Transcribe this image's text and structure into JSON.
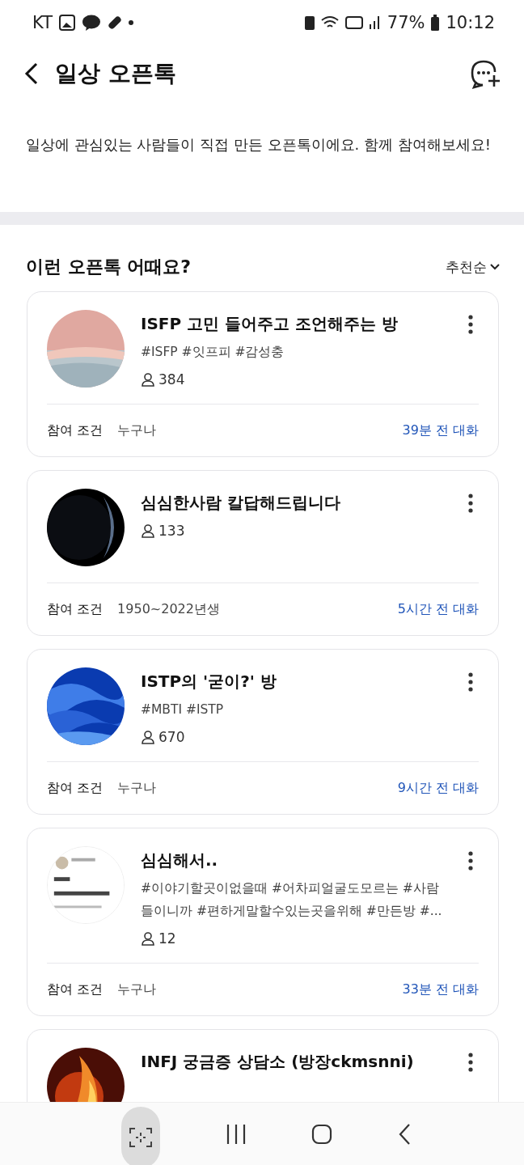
{
  "status_bar": {
    "carrier": "KT",
    "battery": "77%",
    "time": "10:12"
  },
  "header": {
    "title": "일상 오픈톡"
  },
  "description": "일상에 관심있는 사람들이 직접 만든 오픈톡이에요. 함께 참여해보세요!",
  "section": {
    "title": "이런 오픈톡 어때요?",
    "sort": "추천순"
  },
  "rooms": [
    {
      "title": "ISFP 고민 들어주고 조언해주는 방",
      "tags": "#ISFP #잇프피 #감성충",
      "members": "384",
      "condition_label": "참여 조건",
      "condition": "누구나",
      "last_chat": "39분 전 대화"
    },
    {
      "title": "심심한사람 칼답해드립니다",
      "members": "133",
      "condition_label": "참여 조건",
      "condition": "1950~2022년생",
      "last_chat": "5시간 전 대화"
    },
    {
      "title": "ISTP의 '굳이?' 방",
      "tags": "#MBTI #ISTP",
      "members": "670",
      "condition_label": "참여 조건",
      "condition": "누구나",
      "last_chat": "9시간 전 대화"
    },
    {
      "title": "심심해서..",
      "tags": "#이야기할곳이없을때 #어차피얼굴도모르는 #사람들이니까 #편하게말할수있는곳을위해 #만든방 #...",
      "members": "12",
      "condition_label": "참여 조건",
      "condition": "누구나",
      "last_chat": "33분 전 대화"
    },
    {
      "title": "INFJ 궁금증 상담소 (방장ckmsnni)"
    }
  ]
}
